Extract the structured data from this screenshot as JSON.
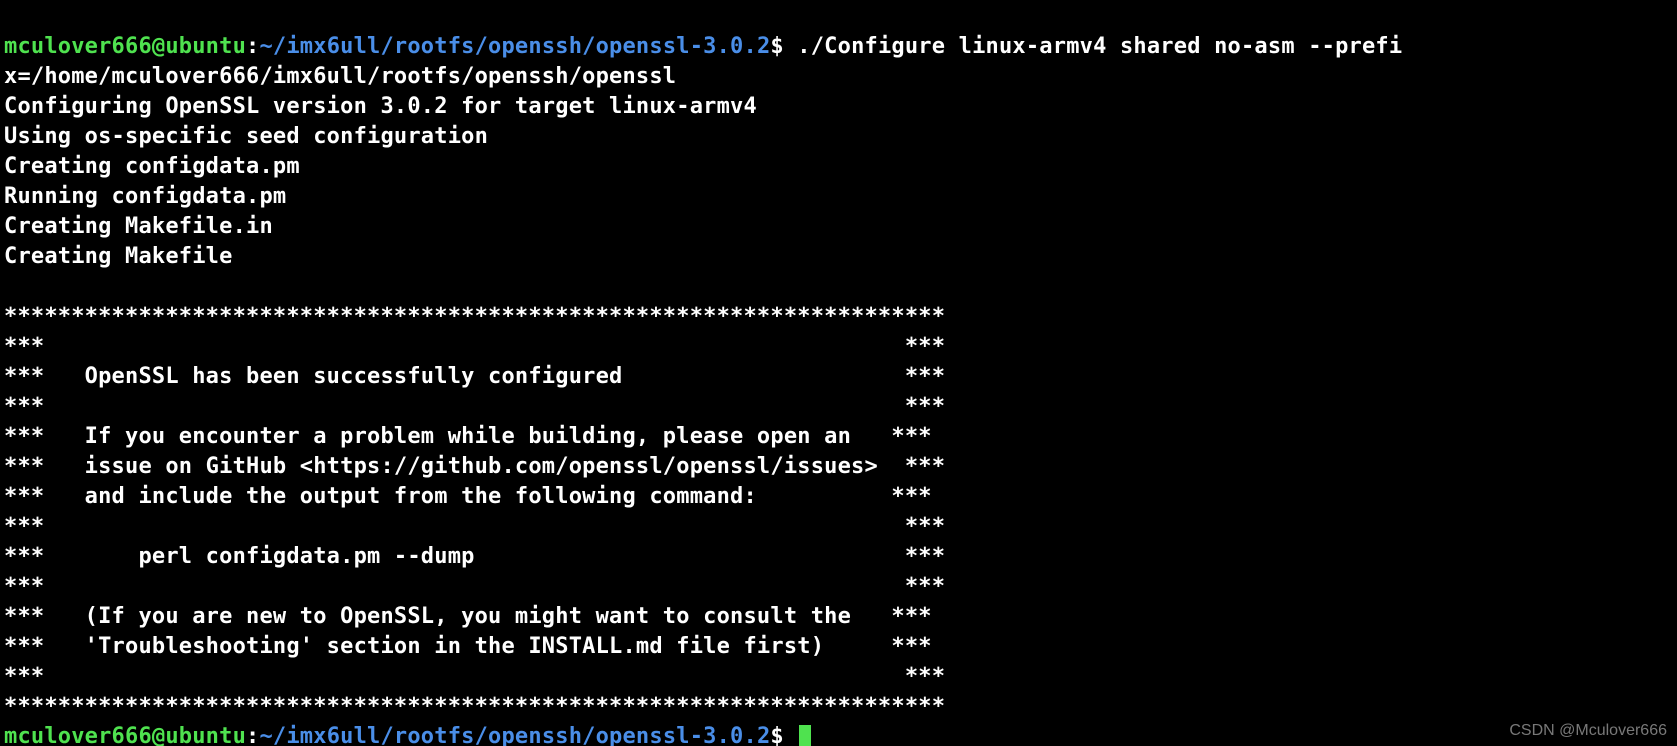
{
  "prompt1": {
    "user": "mculover666@ubuntu",
    "colon": ":",
    "path": "~/imx6ull/rootfs/openssh/openssl-3.0.2",
    "dollar": "$",
    "cmd_part1": " ./Configure linux-armv4 shared no-asm --prefi",
    "cmd_part2": "x=/home/mculover666/imx6ull/rootfs/openssh/openssl"
  },
  "output": {
    "l1": "Configuring OpenSSL version 3.0.2 for target linux-armv4",
    "l2": "Using os-specific seed configuration",
    "l3": "Creating configdata.pm",
    "l4": "Running configdata.pm",
    "l5": "Creating Makefile.in",
    "l6": "Creating Makefile",
    "blank": "",
    "sep": "**********************************************************************",
    "b1": "***                                                                ***",
    "b2": "***   OpenSSL has been successfully configured                     ***",
    "b3": "***                                                                ***",
    "b4": "***   If you encounter a problem while building, please open an   ***",
    "b5": "***   issue on GitHub <https://github.com/openssl/openssl/issues>  ***",
    "b6": "***   and include the output from the following command:          ***",
    "b7": "***                                                                ***",
    "b8": "***       perl configdata.pm --dump                                ***",
    "b9": "***                                                                ***",
    "b10": "***   (If you are new to OpenSSL, you might want to consult the   ***",
    "b11": "***   'Troubleshooting' section in the INSTALL.md file first)     ***",
    "b12": "***                                                                ***"
  },
  "prompt2": {
    "user": "mculover666@ubuntu",
    "colon": ":",
    "path": "~/imx6ull/rootfs/openssh/openssl-3.0.2",
    "dollar": "$ "
  },
  "watermark": "CSDN @Mculover666"
}
